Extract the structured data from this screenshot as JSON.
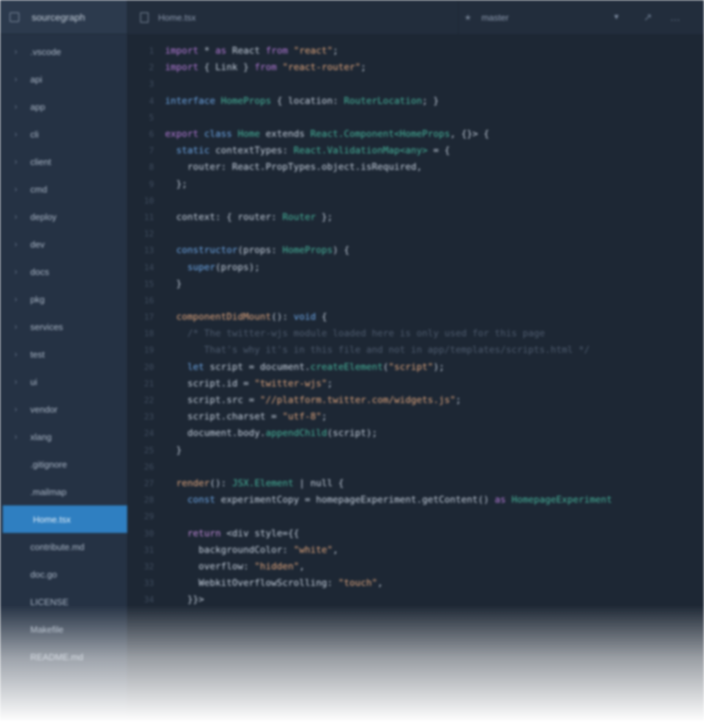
{
  "sidebar": {
    "repo_name": "sourcegraph",
    "items": [
      {
        "label": ".vscode",
        "type": "folder"
      },
      {
        "label": "api",
        "type": "folder"
      },
      {
        "label": "app",
        "type": "folder"
      },
      {
        "label": "cli",
        "type": "folder"
      },
      {
        "label": "client",
        "type": "folder"
      },
      {
        "label": "cmd",
        "type": "folder"
      },
      {
        "label": "deploy",
        "type": "folder"
      },
      {
        "label": "dev",
        "type": "folder"
      },
      {
        "label": "docs",
        "type": "folder"
      },
      {
        "label": "pkg",
        "type": "folder"
      },
      {
        "label": "services",
        "type": "folder"
      },
      {
        "label": "test",
        "type": "folder"
      },
      {
        "label": "ui",
        "type": "folder"
      },
      {
        "label": "vendor",
        "type": "folder"
      },
      {
        "label": "xlang",
        "type": "folder"
      },
      {
        "label": ".gitignore",
        "type": "file"
      },
      {
        "label": ".mailmap",
        "type": "file"
      },
      {
        "label": "Home.tsx",
        "type": "file",
        "selected": true
      },
      {
        "label": "contribute.md",
        "type": "file"
      },
      {
        "label": "doc.go",
        "type": "file"
      },
      {
        "label": "LICENSE",
        "type": "file"
      },
      {
        "label": "Makefile",
        "type": "file"
      },
      {
        "label": "README.md",
        "type": "file"
      }
    ]
  },
  "header": {
    "file_name": "Home.tsx",
    "branch": "master"
  },
  "icons": {
    "repo": "repo-icon",
    "file": "file-icon",
    "branch": "branch-icon",
    "caret": "chevron-down-icon",
    "external": "external-link-icon",
    "more": "more-icon",
    "chevron": "chevron-right-icon"
  },
  "colors": {
    "selected_item": "#2f7fc1",
    "keyword": "#b57ad8",
    "type": "#46b39a",
    "string": "#e3a77d",
    "function": "#6ea8e8"
  },
  "code": [
    {
      "n": "1",
      "toks": [
        [
          "kw",
          "import"
        ],
        [
          "src",
          " * "
        ],
        [
          "kw",
          "as"
        ],
        [
          "src",
          " React "
        ],
        [
          "kw",
          "from"
        ],
        [
          "src",
          " "
        ],
        [
          "st",
          "\"react\""
        ],
        [
          "src",
          ";"
        ]
      ]
    },
    {
      "n": "2",
      "toks": [
        [
          "kw",
          "import"
        ],
        [
          "src",
          " { Link } "
        ],
        [
          "kw",
          "from"
        ],
        [
          "src",
          " "
        ],
        [
          "st",
          "\"react-router\""
        ],
        [
          "src",
          ";"
        ]
      ]
    },
    {
      "n": "3",
      "toks": []
    },
    {
      "n": "4",
      "toks": [
        [
          "fn",
          "interface"
        ],
        [
          "src",
          " "
        ],
        [
          "ty",
          "HomeProps"
        ],
        [
          "src",
          " { location: "
        ],
        [
          "ty",
          "RouterLocation"
        ],
        [
          "src",
          "; }"
        ]
      ]
    },
    {
      "n": "5",
      "toks": []
    },
    {
      "n": "6",
      "toks": [
        [
          "kw",
          "export"
        ],
        [
          "src",
          " "
        ],
        [
          "fn",
          "class"
        ],
        [
          "src",
          " "
        ],
        [
          "ty",
          "Home"
        ],
        [
          "src",
          " extends "
        ],
        [
          "ty",
          "React.Component<HomeProps"
        ],
        [
          "src",
          ", {}> {"
        ]
      ]
    },
    {
      "n": "7",
      "toks": [
        [
          "src",
          "  "
        ],
        [
          "fn",
          "static"
        ],
        [
          "src",
          " contextTypes: "
        ],
        [
          "ty",
          "React.ValidationMap<any>"
        ],
        [
          "src",
          " = {"
        ]
      ]
    },
    {
      "n": "8",
      "toks": [
        [
          "src",
          "    router: React.PropTypes.object.isRequired,"
        ]
      ]
    },
    {
      "n": "9",
      "toks": [
        [
          "src",
          "  };"
        ]
      ]
    },
    {
      "n": "10",
      "toks": []
    },
    {
      "n": "11",
      "toks": [
        [
          "src",
          "  context: { router: "
        ],
        [
          "ty",
          "Router"
        ],
        [
          "src",
          " };"
        ]
      ]
    },
    {
      "n": "12",
      "toks": []
    },
    {
      "n": "13",
      "toks": [
        [
          "src",
          "  "
        ],
        [
          "fn",
          "constructor"
        ],
        [
          "src",
          "(props: "
        ],
        [
          "ty",
          "HomeProps"
        ],
        [
          "src",
          ") {"
        ]
      ]
    },
    {
      "n": "14",
      "toks": [
        [
          "src",
          "    "
        ],
        [
          "fn",
          "super"
        ],
        [
          "src",
          "(props);"
        ]
      ]
    },
    {
      "n": "15",
      "toks": [
        [
          "src",
          "  }"
        ]
      ]
    },
    {
      "n": "16",
      "toks": []
    },
    {
      "n": "17",
      "toks": [
        [
          "src",
          "  "
        ],
        [
          "st",
          "componentDidMount"
        ],
        [
          "src",
          "(): "
        ],
        [
          "fn",
          "void"
        ],
        [
          "src",
          " {"
        ]
      ]
    },
    {
      "n": "18",
      "toks": [
        [
          "cm",
          "    /* The twitter-wjs module loaded here is only used for this page"
        ]
      ]
    },
    {
      "n": "19",
      "toks": [
        [
          "cm",
          "       That's why it's in this file and not in app/templates/scripts.html */"
        ]
      ]
    },
    {
      "n": "20",
      "toks": [
        [
          "src",
          "    "
        ],
        [
          "fn",
          "let"
        ],
        [
          "src",
          " script = document."
        ],
        [
          "ty",
          "createElement"
        ],
        [
          "src",
          "("
        ],
        [
          "st",
          "\"script\""
        ],
        [
          "src",
          ");"
        ]
      ]
    },
    {
      "n": "21",
      "toks": [
        [
          "src",
          "    script.id = "
        ],
        [
          "st",
          "\"twitter-wjs\""
        ],
        [
          "src",
          ";"
        ]
      ]
    },
    {
      "n": "22",
      "toks": [
        [
          "src",
          "    script.src = "
        ],
        [
          "st",
          "\"//platform.twitter.com/widgets.js\""
        ],
        [
          "src",
          ";"
        ]
      ]
    },
    {
      "n": "23",
      "toks": [
        [
          "src",
          "    script.charset = "
        ],
        [
          "st",
          "\"utf-8\""
        ],
        [
          "src",
          ";"
        ]
      ]
    },
    {
      "n": "24",
      "toks": [
        [
          "src",
          "    document.body."
        ],
        [
          "ty",
          "appendChild"
        ],
        [
          "src",
          "(script);"
        ]
      ]
    },
    {
      "n": "25",
      "toks": [
        [
          "src",
          "  }"
        ]
      ]
    },
    {
      "n": "26",
      "toks": []
    },
    {
      "n": "27",
      "toks": [
        [
          "src",
          "  "
        ],
        [
          "st",
          "render"
        ],
        [
          "src",
          "(): "
        ],
        [
          "ty",
          "JSX.Element"
        ],
        [
          "src",
          " | null {"
        ]
      ]
    },
    {
      "n": "28",
      "toks": [
        [
          "src",
          "    "
        ],
        [
          "fn",
          "const"
        ],
        [
          "src",
          " experimentCopy = homepageExperiment.getContent() "
        ],
        [
          "kw",
          "as"
        ],
        [
          "src",
          " "
        ],
        [
          "ty",
          "HomepageExperiment"
        ]
      ]
    },
    {
      "n": "29",
      "toks": []
    },
    {
      "n": "30",
      "toks": [
        [
          "src",
          "    "
        ],
        [
          "ret",
          "return"
        ],
        [
          "src",
          " <div style={{"
        ]
      ]
    },
    {
      "n": "31",
      "toks": [
        [
          "src",
          "      backgroundColor: "
        ],
        [
          "st",
          "\"white\""
        ],
        [
          "src",
          ","
        ]
      ]
    },
    {
      "n": "32",
      "toks": [
        [
          "src",
          "      overflow: "
        ],
        [
          "st",
          "\"hidden\""
        ],
        [
          "src",
          ","
        ]
      ]
    },
    {
      "n": "33",
      "toks": [
        [
          "src",
          "      WebkitOverflowScrolling: "
        ],
        [
          "st",
          "\"touch\""
        ],
        [
          "src",
          ","
        ]
      ]
    },
    {
      "n": "34",
      "toks": [
        [
          "src",
          "    }}>"
        ]
      ]
    }
  ]
}
